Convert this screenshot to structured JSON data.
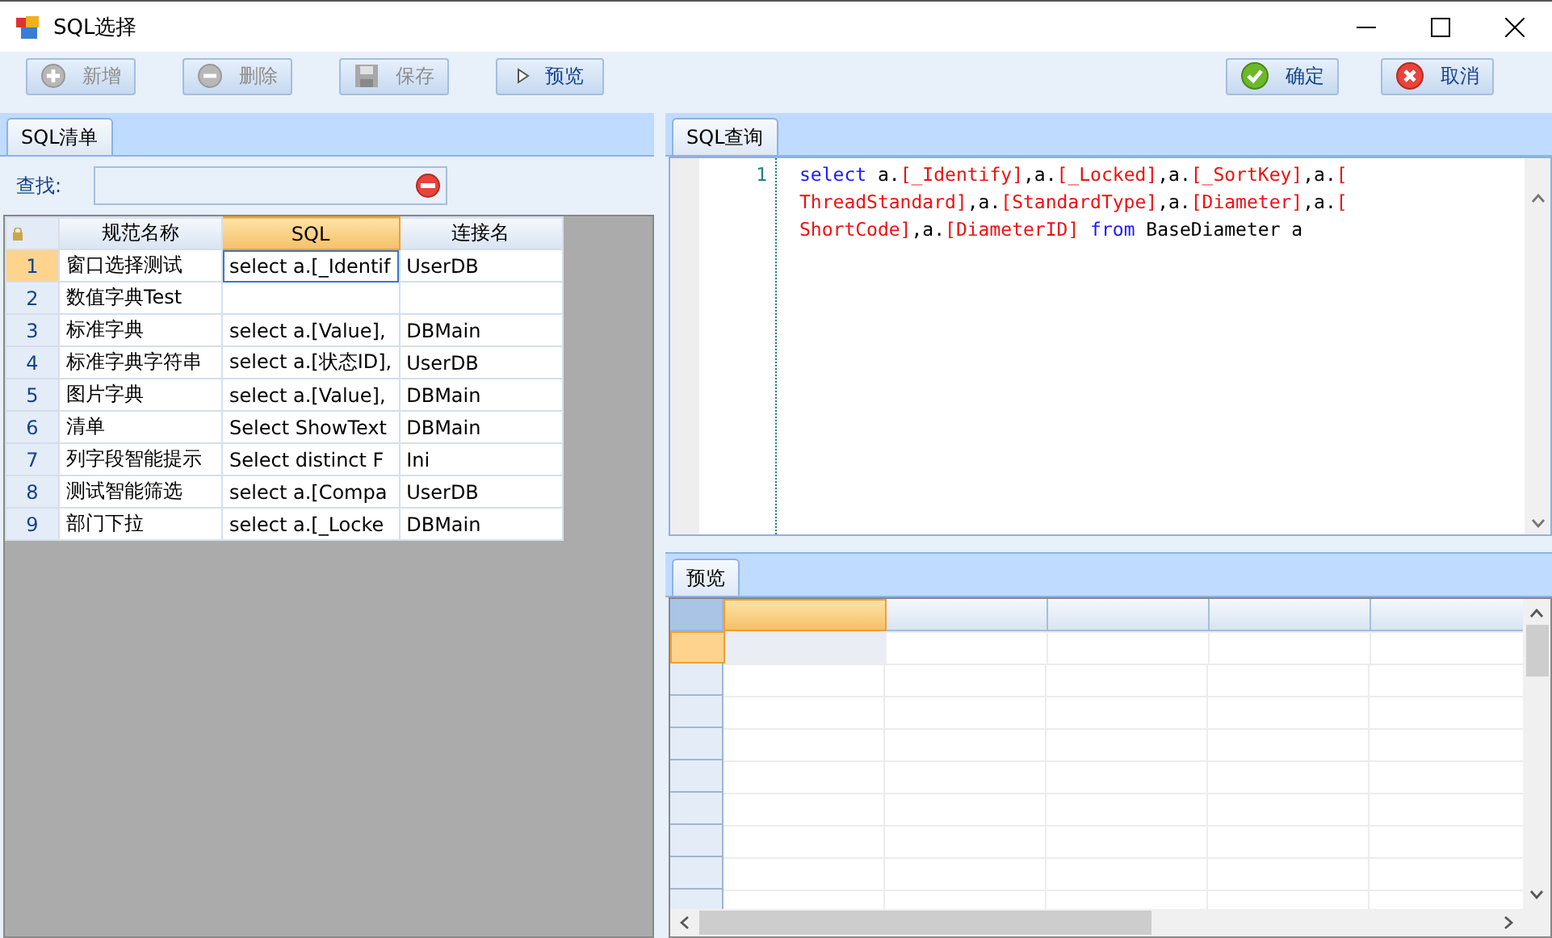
{
  "window": {
    "title": "SQL选择"
  },
  "toolbar": {
    "left": [
      {
        "label": "新增",
        "kind": "add",
        "disabled": true
      },
      {
        "label": "删除",
        "kind": "remove",
        "disabled": true
      },
      {
        "label": "保存",
        "kind": "save",
        "disabled": true
      },
      {
        "label": "预览",
        "kind": "play",
        "disabled": false
      }
    ],
    "right": [
      {
        "label": "确定",
        "kind": "ok",
        "disabled": false
      },
      {
        "label": "取消",
        "kind": "cancel",
        "disabled": false
      }
    ]
  },
  "left_panel": {
    "tab": "SQL清单",
    "search_label": "查找:",
    "grid": {
      "columns": [
        {
          "label": "规范名称",
          "selected": false
        },
        {
          "label": "SQL",
          "selected": true
        },
        {
          "label": "连接名",
          "selected": false
        }
      ],
      "rows": [
        {
          "number": "1",
          "selected": true,
          "cells": [
            {
              "text": "窗口选择测试",
              "current": false
            },
            {
              "text": "select a.[_Identif",
              "current": true
            },
            {
              "text": "UserDB",
              "current": false
            }
          ]
        },
        {
          "number": "2",
          "selected": false,
          "cells": [
            {
              "text": "数值字典Test",
              "current": false
            },
            {
              "current": false
            },
            {
              "current": false
            }
          ]
        },
        {
          "number": "3",
          "selected": false,
          "cells": [
            {
              "text": "标准字典",
              "current": false
            },
            {
              "text": "select a.[Value],",
              "current": false
            },
            {
              "text": "DBMain",
              "current": false
            }
          ]
        },
        {
          "number": "4",
          "selected": false,
          "cells": [
            {
              "text": "标准字典字符串",
              "current": false
            },
            {
              "text": "select a.[状态ID],",
              "current": false
            },
            {
              "text": "UserDB",
              "current": false
            }
          ]
        },
        {
          "number": "5",
          "selected": false,
          "cells": [
            {
              "text": "图片字典",
              "current": false
            },
            {
              "text": "select a.[Value],",
              "current": false
            },
            {
              "text": "DBMain",
              "current": false
            }
          ]
        },
        {
          "number": "6",
          "selected": false,
          "cells": [
            {
              "text": "清单",
              "current": false
            },
            {
              "text": "Select ShowText",
              "current": false
            },
            {
              "text": "DBMain",
              "current": false
            }
          ]
        },
        {
          "number": "7",
          "selected": false,
          "cells": [
            {
              "text": "列字段智能提示",
              "current": false
            },
            {
              "text": "Select distinct F",
              "current": false
            },
            {
              "text": "Ini",
              "current": false
            }
          ]
        },
        {
          "number": "8",
          "selected": false,
          "cells": [
            {
              "text": "测试智能筛选",
              "current": false
            },
            {
              "text": "select a.[Compa",
              "current": false
            },
            {
              "text": "UserDB",
              "current": false
            }
          ]
        },
        {
          "number": "9",
          "selected": false,
          "cells": [
            {
              "text": "部门下拉",
              "current": false
            },
            {
              "text": "select a.[_Locke",
              "current": false
            },
            {
              "text": "DBMain",
              "current": false
            }
          ]
        }
      ]
    }
  },
  "query_panel": {
    "tab": "SQL查询",
    "line_number": "1",
    "lines": [
      [
        {
          "kind": "keyword",
          "text": "select"
        },
        {
          "kind": "plain",
          "text": " a."
        },
        {
          "kind": "field",
          "text": "[_Identify]"
        },
        {
          "kind": "plain",
          "text": ",a."
        },
        {
          "kind": "field",
          "text": "[_Locked]"
        },
        {
          "kind": "plain",
          "text": ",a."
        },
        {
          "kind": "field",
          "text": "[_SortKey]"
        },
        {
          "kind": "plain",
          "text": ",a."
        },
        {
          "kind": "field",
          "text": "["
        }
      ],
      [
        {
          "kind": "field",
          "text": "ThreadStandard]"
        },
        {
          "kind": "plain",
          "text": ",a."
        },
        {
          "kind": "field",
          "text": "[StandardType]"
        },
        {
          "kind": "plain",
          "text": ",a."
        },
        {
          "kind": "field",
          "text": "[Diameter]"
        },
        {
          "kind": "plain",
          "text": ",a."
        },
        {
          "kind": "field",
          "text": "["
        }
      ],
      [
        {
          "kind": "field",
          "text": "ShortCode]"
        },
        {
          "kind": "plain",
          "text": ",a."
        },
        {
          "kind": "field",
          "text": "[DiameterID]"
        },
        {
          "kind": "keyword",
          "text": "from",
          "space_before": true
        },
        {
          "kind": "plain",
          "text": " BaseDiameter a"
        }
      ]
    ]
  },
  "preview_panel": {
    "tab": "预览",
    "columns": [
      {
        "selected": true
      },
      {
        "selected": false
      },
      {
        "selected": false
      },
      {
        "selected": false
      },
      {
        "selected": false
      }
    ],
    "rows": [
      {
        "selected": true
      },
      {
        "selected": false
      },
      {
        "selected": false
      },
      {
        "selected": false
      },
      {
        "selected": false
      },
      {
        "selected": false
      },
      {
        "selected": false
      },
      {
        "selected": false
      },
      {
        "selected": false
      }
    ]
  }
}
